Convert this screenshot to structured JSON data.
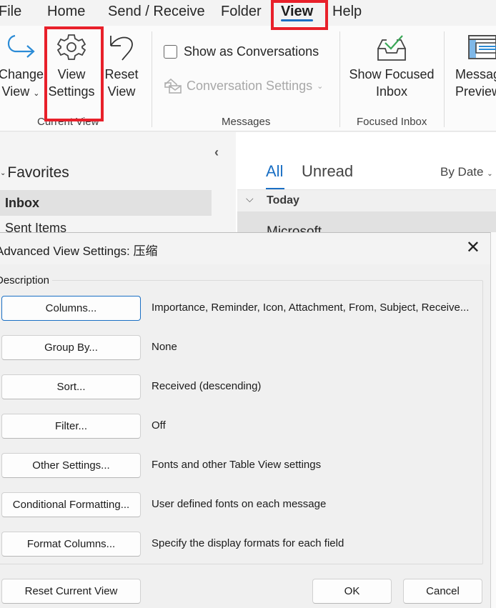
{
  "ribbon_tabs": {
    "file": "File",
    "home": "Home",
    "send_receive": "Send / Receive",
    "folder": "Folder",
    "view": "View",
    "help": "Help"
  },
  "ribbon": {
    "change_view": {
      "line1": "Change",
      "line2": "View"
    },
    "view_settings": {
      "line1": "View",
      "line2": "Settings"
    },
    "reset_view": {
      "line1": "Reset",
      "line2": "View"
    },
    "current_view_group": "Current View",
    "show_as_conversations": "Show as Conversations",
    "show_as_conversations_checked": false,
    "conversation_settings": "Conversation Settings",
    "messages_group": "Messages",
    "show_focused_inbox": {
      "line1": "Show Focused",
      "line2": "Inbox"
    },
    "focused_inbox_group": "Focused Inbox",
    "message_preview": {
      "line1": "Message",
      "line2": "Preview"
    }
  },
  "folder_pane": {
    "favorites": "Favorites",
    "items": [
      {
        "label": "Inbox",
        "selected": true
      },
      {
        "label": "Sent Items",
        "selected": false
      }
    ]
  },
  "message_list": {
    "filters": [
      "All",
      "Unread"
    ],
    "active_filter": "All",
    "sort": "By Date",
    "group_header": "Today",
    "first_sender": "Microsoft"
  },
  "dialog": {
    "title": "Advanced View Settings: 压缩",
    "section": "Description",
    "rows": [
      {
        "button": "Columns...",
        "description": "Importance, Reminder, Icon, Attachment, From, Subject, Receive..."
      },
      {
        "button": "Group By...",
        "description": "None"
      },
      {
        "button": "Sort...",
        "description": "Received (descending)"
      },
      {
        "button": "Filter...",
        "description": "Off"
      },
      {
        "button": "Other Settings...",
        "description": "Fonts and other Table View settings"
      },
      {
        "button": "Conditional Formatting...",
        "description": "User defined fonts on each message"
      },
      {
        "button": "Format Columns...",
        "description": "Specify the display formats for each field"
      }
    ],
    "reset_button": "Reset Current View",
    "ok_button": "OK",
    "cancel_button": "Cancel"
  },
  "colors": {
    "accent": "#1a6fc4",
    "highlight": "#e8202a",
    "focused_check": "#3aa757"
  }
}
